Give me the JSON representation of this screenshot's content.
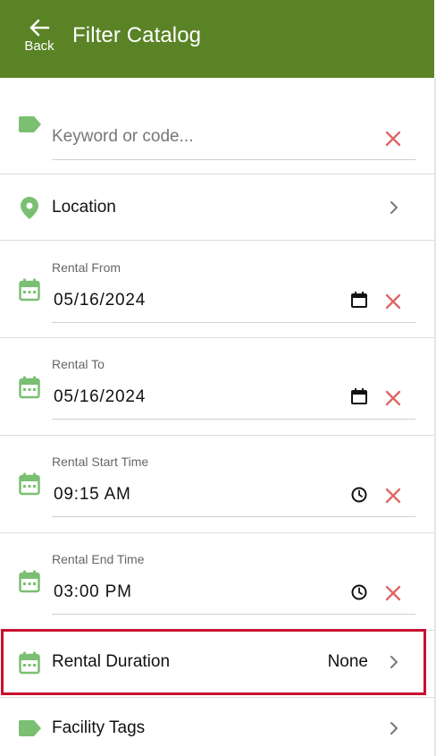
{
  "header": {
    "back_label": "Back",
    "title": "Filter Catalog"
  },
  "keyword": {
    "placeholder": "Keyword or code..."
  },
  "location": {
    "label": "Location"
  },
  "rental_from": {
    "label": "Rental From",
    "value": "05/16/2024"
  },
  "rental_to": {
    "label": "Rental To",
    "value": "05/16/2024"
  },
  "rental_start_time": {
    "label": "Rental Start Time",
    "value": "09:15 AM"
  },
  "rental_end_time": {
    "label": "Rental End Time",
    "value": "03:00 PM"
  },
  "rental_duration": {
    "label": "Rental Duration",
    "value": "None"
  },
  "facility_tags": {
    "label": "Facility Tags"
  },
  "colors": {
    "header_bg": "#5a8326",
    "icon_green": "#7bbf72",
    "clear_red": "#e06666",
    "highlight": "#c8102e"
  },
  "icons": [
    "arrow-left-icon",
    "tag-icon",
    "clear-icon",
    "map-pin-icon",
    "chevron-right-icon",
    "calendar-icon",
    "date-picker-icon",
    "clock-icon"
  ]
}
